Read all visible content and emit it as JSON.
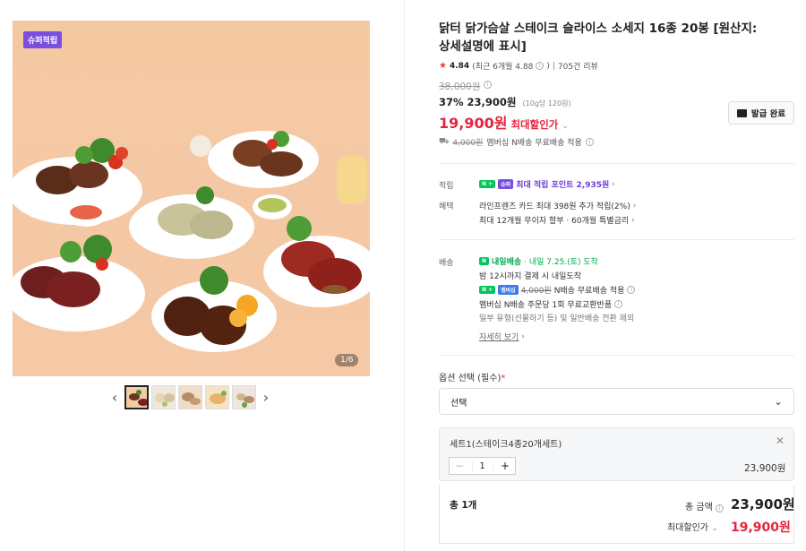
{
  "gallery": {
    "badge": "슈퍼적립",
    "counter": "1/6",
    "prev": "‹",
    "next": "›",
    "thumb_count": 5
  },
  "product": {
    "title": "닭터 닭가슴살 스테이크 슬라이스 소세지 16종 20봉 [원산지: 상세설명에 표시]",
    "rating": "4.84",
    "rating_recent": "(최근 6개월 4.88",
    "rating_recent_close": ")",
    "reviews": "705건 리뷰",
    "original_price": "38,000원",
    "discount_pct": "37%",
    "sale_price": "23,900원",
    "unit_price": "(10g당 120원)",
    "final_price": "19,900원",
    "final_label": "최대할인가",
    "coupon_button": "발급 완료",
    "membership_strike": "4,000원",
    "membership_text": "멤버십 N배송 무료배송 적용"
  },
  "benefits": {
    "points_label": "적립",
    "points_text": "최대 적립 포인트 2,935원",
    "perks_label": "혜택",
    "perk1": "라인프렌즈 카드 최대 398원 추가 적립(2%)",
    "perk2": "최대 12개월 무이자 할부 · 60개월 특별금리"
  },
  "shipping": {
    "label": "배송",
    "tag": "내일배송",
    "arrival": "· 내일 7.25.(토) 도착",
    "cutoff": "밤 12시까지 결제 시 내일도착",
    "member_tag": "멤버십",
    "fee_strike": "4,000원",
    "fee_text": "N배송 무료배송 적용",
    "exchange": "멤버십 N배송 주문당 1회 무료교환반품",
    "exclude": "일부 유형(선물하기 등) 및 일반배송 전환 제외",
    "more": "자세히 보기"
  },
  "options": {
    "label": "옵션 선택 (필수)",
    "required_mark": "*",
    "select_value": "선택",
    "selected_name": "세트1(스테이크4종20개세트)",
    "qty": "1",
    "selected_price": "23,900원",
    "total_count": "총 1개",
    "total_amt_label": "총 금액",
    "total_amt": "23,900원",
    "max_label": "최대할인가",
    "max_price": "19,900원"
  }
}
